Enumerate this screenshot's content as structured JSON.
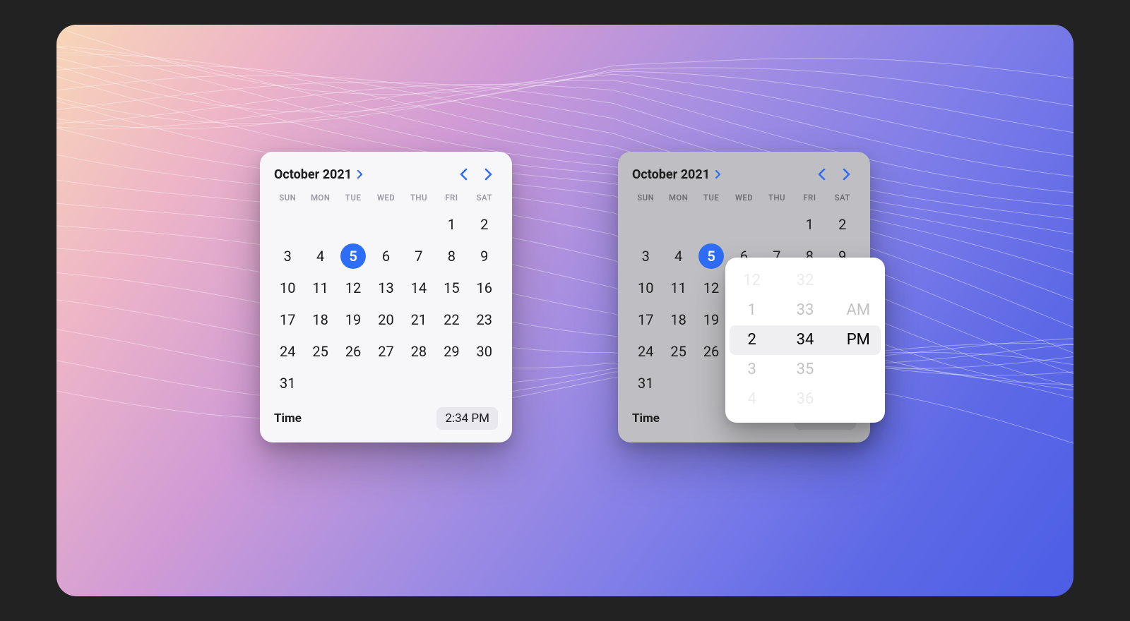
{
  "calendar": {
    "title": "October 2021",
    "weekdays": [
      "SUN",
      "MON",
      "TUE",
      "WED",
      "THU",
      "FRI",
      "SAT"
    ],
    "leading_blanks": 5,
    "days": [
      "1",
      "2",
      "3",
      "4",
      "5",
      "6",
      "7",
      "8",
      "9",
      "10",
      "11",
      "12",
      "13",
      "14",
      "15",
      "16",
      "17",
      "18",
      "19",
      "20",
      "21",
      "22",
      "23",
      "24",
      "25",
      "26",
      "27",
      "28",
      "29",
      "30",
      "31"
    ],
    "selected_day": "5",
    "time_label": "Time",
    "time_value": "2:34 PM",
    "accent": "#2e6df6"
  },
  "time_picker": {
    "hours": {
      "minus2": "12",
      "minus1": "1",
      "center": "2",
      "plus1": "3",
      "plus2": "4"
    },
    "minutes": {
      "minus2": "32",
      "minus1": "33",
      "center": "34",
      "plus1": "35",
      "plus2": "36"
    },
    "period": {
      "minus1": "AM",
      "center": "PM"
    }
  }
}
